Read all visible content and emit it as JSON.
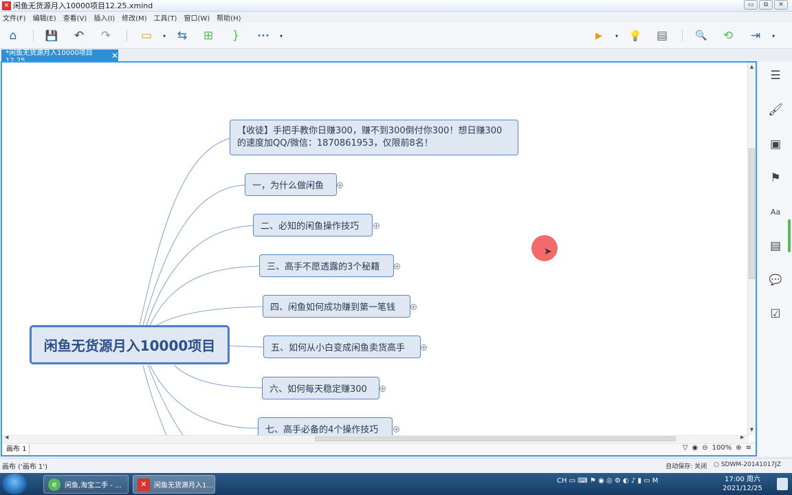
{
  "window": {
    "title": "闲鱼无货源月入10000项目12.25.xmind",
    "min_icon": "▭",
    "max_icon": "⧉",
    "close_icon": "✕"
  },
  "menu": [
    "文件(F)",
    "编辑(E)",
    "查看(V)",
    "插入(I)",
    "修改(M)",
    "工具(T)",
    "窗口(W)",
    "帮助(H)"
  ],
  "tab": {
    "label": "*闲鱼无货源月入10000项目12.25",
    "close": "✕"
  },
  "toolbar_icons": {
    "home": "⌂",
    "save": "💾",
    "undo": "↶",
    "redo": "↷",
    "topic": "▭",
    "relationship": "⇆",
    "structure": "⊞",
    "boundary": "}",
    "more": "•••",
    "caret": "▾",
    "presentation": "▶",
    "idea": "💡",
    "outline": "▤",
    "search": "🔍",
    "share": "⟲",
    "export": "⇥"
  },
  "mindmap": {
    "root": "闲鱼无货源月入10000项目",
    "topics": [
      "【收徒】手把手教你日赚300，赚不到300倒付你300！想日赚300的速度加QQ/微信：1870861953，仅限前8名！",
      "一，为什么做闲鱼",
      "二、必知的闲鱼操作技巧",
      "三、高手不愿透露的3个秘籍",
      "四、闲鱼如何成功赚到第一笔钱",
      "五、如何从小白变成闲鱼卖货高手",
      "六、如何每天稳定赚300",
      "七、高手必备的4个操作技巧"
    ],
    "expand_symbol": "+"
  },
  "sheet": {
    "tab": "画布 1",
    "zoom": "100%",
    "filter": "▽",
    "eye": "◉",
    "minus": "⊖",
    "plus": "⊕",
    "menu": "≡"
  },
  "scroll": {
    "up": "▲",
    "down": "▼",
    "left": "◀",
    "right": "▶",
    "grip": "|||"
  },
  "rightbar": {
    "outline_icon": "☰",
    "format_icon": "🖌",
    "image_icon": "▣",
    "marker_icon": "⚑",
    "label_icon": "Aa",
    "notes_icon": "▤",
    "comments_icon": "💬",
    "task_icon": "☑"
  },
  "status": {
    "left": "画布 ('画布 1')",
    "autosave": "自动保存: 关闭",
    "user": "○ SDWM-20141017JZ"
  },
  "taskbar": {
    "task1": "闲鱼,淘宝二手 - ...",
    "task2": "闲鱼无货源月入1...",
    "task1_icon": "e",
    "task2_icon": "✕",
    "tray": "CH ▭ ⌨ ⚑ ◉ ◎ ⚙ ◐ ♪ ▮ ▭ M",
    "time": "17:00 周六",
    "date": "2021/12/25"
  }
}
